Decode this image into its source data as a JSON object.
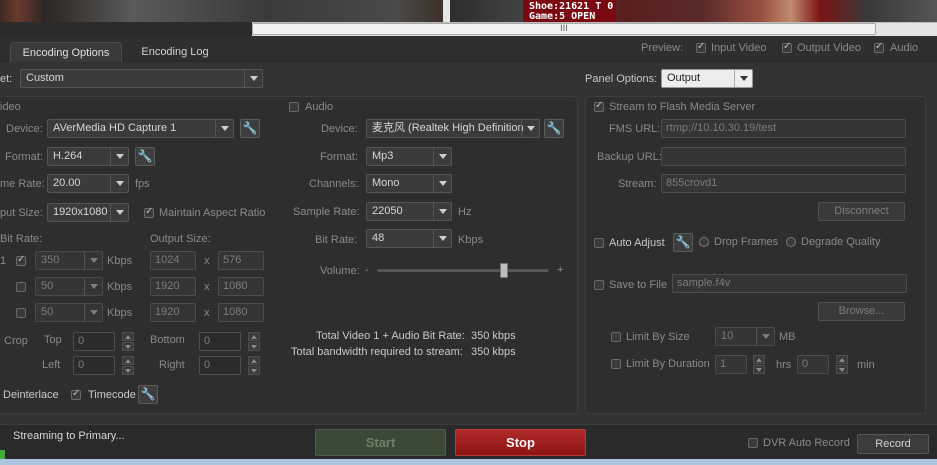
{
  "preview_video": {
    "score_line1": "Shoe:21621 T 0",
    "score_line2": "Game:5   OPEN"
  },
  "scrollbar": {
    "grip": "III"
  },
  "tabs": [
    {
      "label": "Encoding Options"
    },
    {
      "label": "Encoding Log"
    }
  ],
  "preview_options": {
    "label": "Preview:",
    "input_video": "Input Video",
    "output_video": "Output Video",
    "audio": "Audio"
  },
  "preset": {
    "label": "et:",
    "value": "Custom"
  },
  "panel_options": {
    "label": "Panel Options:",
    "value": "Output"
  },
  "video": {
    "section_label": "ideo",
    "device_label": "Device:",
    "device_value": "AVerMedia HD Capture 1",
    "format_label": "Format:",
    "format_value": "H.264",
    "frame_rate_label": "me Rate:",
    "frame_rate_value": "20.00",
    "frame_rate_unit": "fps",
    "input_size_label": "put Size:",
    "input_size_value": "1920x1080",
    "maintain_aspect": "Maintain Aspect Ratio",
    "bit_rate_label": "Bit Rate:",
    "output_size_label": "Output Size:",
    "rows": [
      {
        "index": "1",
        "bitrate": "350",
        "unit": "Kbps",
        "w": "1024",
        "x": "x",
        "h": "576"
      },
      {
        "index": "",
        "bitrate": "50",
        "unit": "Kbps",
        "w": "1920",
        "x": "x",
        "h": "1080"
      },
      {
        "index": "",
        "bitrate": "50",
        "unit": "Kbps",
        "w": "1920",
        "x": "x",
        "h": "1080"
      }
    ],
    "crop_label": "Crop",
    "top_label": "Top",
    "left_label": "Left",
    "bottom_label": "Bottom",
    "right_label": "Right",
    "top_value": "0",
    "left_value": "0",
    "bottom_value": "0",
    "right_value": "0",
    "deinterlace": "Deinterlace",
    "timecode": "Timecode"
  },
  "audio": {
    "section_label": "Audio",
    "device_label": "Device:",
    "device_value": "麦克风 (Realtek High Definition",
    "format_label": "Format:",
    "format_value": "Mp3",
    "channels_label": "Channels:",
    "channels_value": "Mono",
    "sample_rate_label": "Sample Rate:",
    "sample_rate_value": "22050",
    "sample_rate_unit": "Hz",
    "bit_rate_label": "Bit Rate:",
    "bit_rate_value": "48",
    "bit_rate_unit": "Kbps",
    "volume_label": "Volume:",
    "volume_minus": "-",
    "volume_plus": "+",
    "volume_level": 0.74
  },
  "totals": {
    "total_bitrate_label": "Total Video 1 + Audio Bit Rate:",
    "total_bitrate_value": "350 kbps",
    "total_bandwidth_label": "Total bandwidth required to stream:",
    "total_bandwidth_value": "350 kbps"
  },
  "output": {
    "stream_to_fms": "Stream to Flash Media Server",
    "fms_url_label": "FMS URL:",
    "fms_url_value": "rtmp://10.10.30.19/test",
    "backup_url_label": "Backup URL:",
    "backup_url_value": "",
    "stream_label": "Stream:",
    "stream_value": "855crovd1",
    "disconnect": "Disconnect",
    "auto_adjust": "Auto Adjust",
    "drop_frames": "Drop Frames",
    "degrade_quality": "Degrade Quality",
    "save_to_file": "Save to File",
    "file_value": "sample.f4v",
    "browse": "Browse...",
    "limit_by_size": "Limit By Size",
    "limit_size_value": "10",
    "limit_size_unit": "MB",
    "limit_by_duration": "Limit By Duration",
    "duration_hrs_value": "1",
    "duration_hrs_unit": "hrs",
    "duration_min_value": "0",
    "duration_min_unit": "min"
  },
  "bottom": {
    "status": "Streaming to Primary...",
    "start": "Start",
    "stop": "Stop",
    "dvr_auto_record": "DVR Auto Record",
    "record": "Record"
  },
  "colors": {
    "background": "#333333",
    "stop_red": "#a01e1e",
    "start_green": "#3b4a37"
  }
}
